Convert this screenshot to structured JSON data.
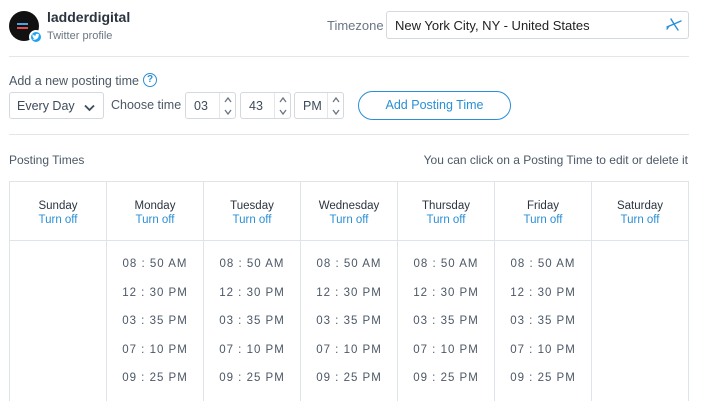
{
  "profile": {
    "name": "ladderdigital",
    "type": "Twitter profile"
  },
  "timezone": {
    "label": "Timezone",
    "value": "New York City, NY - United States"
  },
  "add": {
    "label": "Add a new posting time",
    "frequency": "Every Day",
    "choose_label": "Choose time",
    "hour": "03",
    "minute": "43",
    "ampm": "PM",
    "button": "Add Posting Time"
  },
  "posting": {
    "title": "Posting Times",
    "hint": "You can click on a Posting Time to edit or delete it"
  },
  "days": [
    {
      "name": "Sunday",
      "action": "Turn off",
      "times": []
    },
    {
      "name": "Monday",
      "action": "Turn off",
      "times": [
        "08 : 50  AM",
        "12 : 30  PM",
        "03 : 35  PM",
        "07 : 10  PM",
        "09 : 25  PM"
      ]
    },
    {
      "name": "Tuesday",
      "action": "Turn off",
      "times": [
        "08 : 50  AM",
        "12 : 30  PM",
        "03 : 35  PM",
        "07 : 10  PM",
        "09 : 25  PM"
      ]
    },
    {
      "name": "Wednesday",
      "action": "Turn off",
      "times": [
        "08 : 50  AM",
        "12 : 30  PM",
        "03 : 35  PM",
        "07 : 10  PM",
        "09 : 25  PM"
      ]
    },
    {
      "name": "Thursday",
      "action": "Turn off",
      "times": [
        "08 : 50  AM",
        "12 : 30  PM",
        "03 : 35  PM",
        "07 : 10  PM",
        "09 : 25  PM"
      ]
    },
    {
      "name": "Friday",
      "action": "Turn off",
      "times": [
        "08 : 50  AM",
        "12 : 30  PM",
        "03 : 35  PM",
        "07 : 10  PM",
        "09 : 25  PM"
      ]
    },
    {
      "name": "Saturday",
      "action": "Turn off",
      "times": []
    }
  ],
  "colors": {
    "accent": "#2a8fd6",
    "twitter": "#1da1f2"
  }
}
